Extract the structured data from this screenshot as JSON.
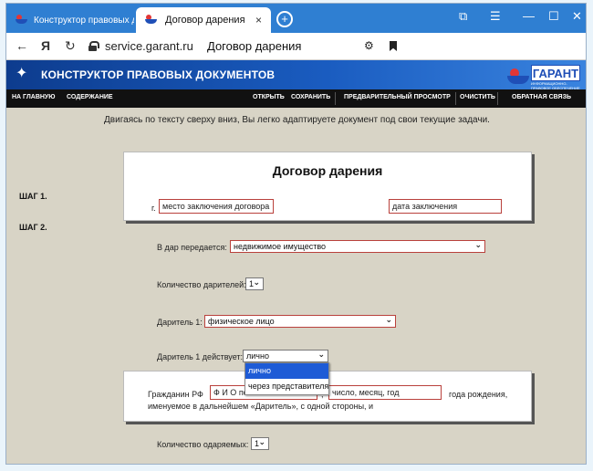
{
  "browser": {
    "tabs": [
      {
        "label": "Конструктор правовых д"
      },
      {
        "label": "Договор дарения",
        "close": "×"
      }
    ],
    "new_tab": "+",
    "url_host": "service.garant.ru",
    "url_title": "Договор дарения"
  },
  "site": {
    "title": "КОНСТРУКТОР ПРАВОВЫХ ДОКУМЕНТОВ",
    "logo_word": "ГАРАНТ",
    "logo_sub": "ИНФОРМАЦИОННО-ПРАВОВОЕ ОБЕСПЕЧЕНИЕ"
  },
  "menu": {
    "home": "НА ГЛАВНУЮ",
    "contents": "СОДЕРЖАНИЕ",
    "open": "ОТКРЫТЬ",
    "save": "СОХРАНИТЬ",
    "preview": "ПРЕДВАРИТЕЛЬНЫЙ ПРОСМОТР",
    "clear": "ОЧИСТИТЬ",
    "feedback": "ОБРАТНАЯ СВЯЗЬ"
  },
  "intro": "Двигаясь по тексту сверху вниз, Вы легко адаптируете документ под свои текущие задачи.",
  "steps": {
    "step1": "ШАГ 1.",
    "step2": "ШАГ 2."
  },
  "document": {
    "title": "Договор дарения",
    "city_prefix": "г.",
    "place_value": "место заключения договора",
    "date_value": "дата заключения"
  },
  "form": {
    "gift_label": "В дар передается:",
    "gift_value": "недвижимое имущество",
    "donors_count_label": "Количество дарителей:",
    "donors_count_value": "1",
    "donor1_label": "Даритель 1:",
    "donor1_value": "физическое лицо",
    "donor1_acts_label": "Даритель 1 действует:",
    "donor1_acts_value": "лично",
    "donor1_acts_options": [
      "лично",
      "через представителя"
    ],
    "recipients_count_label": "Количество одаряемых:",
    "recipients_count_value": "1"
  },
  "party": {
    "citizen_prefix": "Гражданин РФ",
    "fio_value": "Ф И О полностью",
    "comma": ",",
    "birth_value": "число, месяц, год",
    "birth_suffix": "года рождения,",
    "line2": "именуемое в дальнейшем «Даритель», с одной стороны, и"
  }
}
